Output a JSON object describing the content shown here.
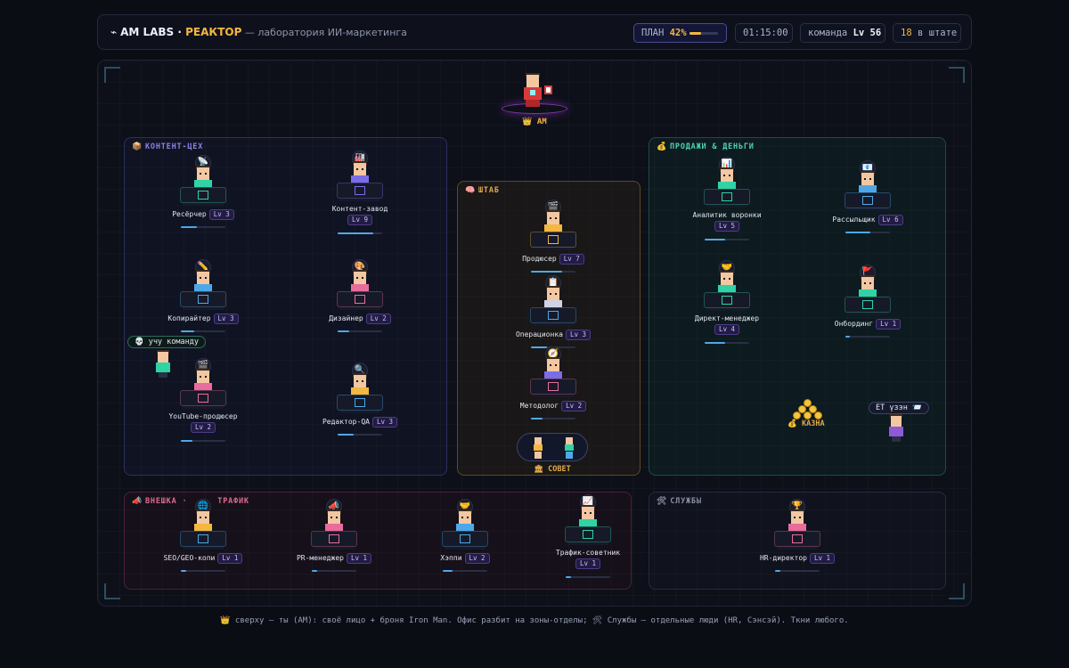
{
  "header": {
    "brand_icon": "⌁",
    "brand_name": "AM LABS · ",
    "brand_accent": "РЕАКТОР",
    "brand_sub": " — лаборатория ИИ-маркетинга",
    "plan_label": "ПЛАН ",
    "plan_value": "42%",
    "plan_progress": 0.42,
    "timer": "01:15:00",
    "team_label": "команда ",
    "team_level": "Lv 56",
    "staff_count": "18",
    "staff_label": " в штате",
    "accent_color": "#f4b740"
  },
  "boss": {
    "label": "👑 AM"
  },
  "zones": {
    "content": {
      "icon": "📦",
      "title": "КОНТЕНТ-ЦЕХ"
    },
    "hq": {
      "icon": "🧠",
      "title": "ШТАБ"
    },
    "sales": {
      "icon": "💰",
      "title": "ПРОДАЖИ & ДЕНЬГИ"
    },
    "traffic": {
      "icon": "📣",
      "title": "ВНЕШКА · ",
      "title_tail": "ТРАФИК"
    },
    "services": {
      "icon": "🛠",
      "title": "СЛУЖБЫ"
    }
  },
  "agents": {
    "researcher": {
      "name": "Ресёрчер",
      "level": "Lv 3",
      "xp": 0.35,
      "icon": "📡"
    },
    "content_factory": {
      "name": "Контент-завод",
      "level": "Lv 9",
      "xp": 0.8,
      "icon": "🏭"
    },
    "copywriter": {
      "name": "Копирайтер",
      "level": "Lv 3",
      "xp": 0.3,
      "icon": "✏️"
    },
    "designer": {
      "name": "Дизайнер",
      "level": "Lv 2",
      "xp": 0.25,
      "icon": "🎨"
    },
    "youtube": {
      "name": "YouTube-продюсер",
      "level": "Lv 2",
      "xp": 0.25,
      "icon": "🎬"
    },
    "editor": {
      "name": "Редактор-QA",
      "level": "Lv 3",
      "xp": 0.35,
      "icon": "🔍"
    },
    "producer": {
      "name": "Продюсер",
      "level": "Lv 7",
      "xp": 0.7,
      "icon": "🎬"
    },
    "operations": {
      "name": "Операционка",
      "level": "Lv 3",
      "xp": 0.35,
      "icon": "📋"
    },
    "methodologist": {
      "name": "Методолог",
      "level": "Lv 2",
      "xp": 0.25,
      "icon": "🧭"
    },
    "funnel_analyst": {
      "name": "Аналитик воронки",
      "level": "Lv 5",
      "xp": 0.45,
      "icon": "📊"
    },
    "mailer": {
      "name": "Рассыльщик",
      "level": "Lv 6",
      "xp": 0.55,
      "icon": "📧"
    },
    "direct_manager": {
      "name": "Директ-менеджер",
      "level": "Lv 4",
      "xp": 0.45,
      "icon": "🤝"
    },
    "onboarding": {
      "name": "Онбординг",
      "level": "Lv 1",
      "xp": 0.1,
      "icon": "🚩"
    },
    "seo": {
      "name": "SEO/GEO-копи",
      "level": "Lv 1",
      "xp": 0.12,
      "icon": "🌐"
    },
    "pr": {
      "name": "PR-менеджер",
      "level": "Lv 1",
      "xp": 0.12,
      "icon": "📣"
    },
    "happy": {
      "name": "Хэппи",
      "level": "Lv 2",
      "xp": 0.22,
      "icon": "🤝"
    },
    "traffic_advisor": {
      "name": "Трафик-советник",
      "level": "Lv 1",
      "xp": 0.12,
      "icon": "📈"
    },
    "hr": {
      "name": "HR-директор",
      "level": "Lv 1",
      "xp": 0.12,
      "icon": "🏆"
    }
  },
  "roaming": {
    "learner_bubble": "💀 учу команду",
    "sensei_bubble": "ET үзэн 📨"
  },
  "council": {
    "label": "🏛 СОВЕТ"
  },
  "treasury": {
    "label": "💰 КАЗНА"
  },
  "footer": {
    "hint": "👑 сверху — ты (AM): своё лицо + броня Iron Man. Офис разбит на зоны-отделы; 🛠 Службы — отдельные люди (HR, Сэнсэй). Ткни любого."
  }
}
